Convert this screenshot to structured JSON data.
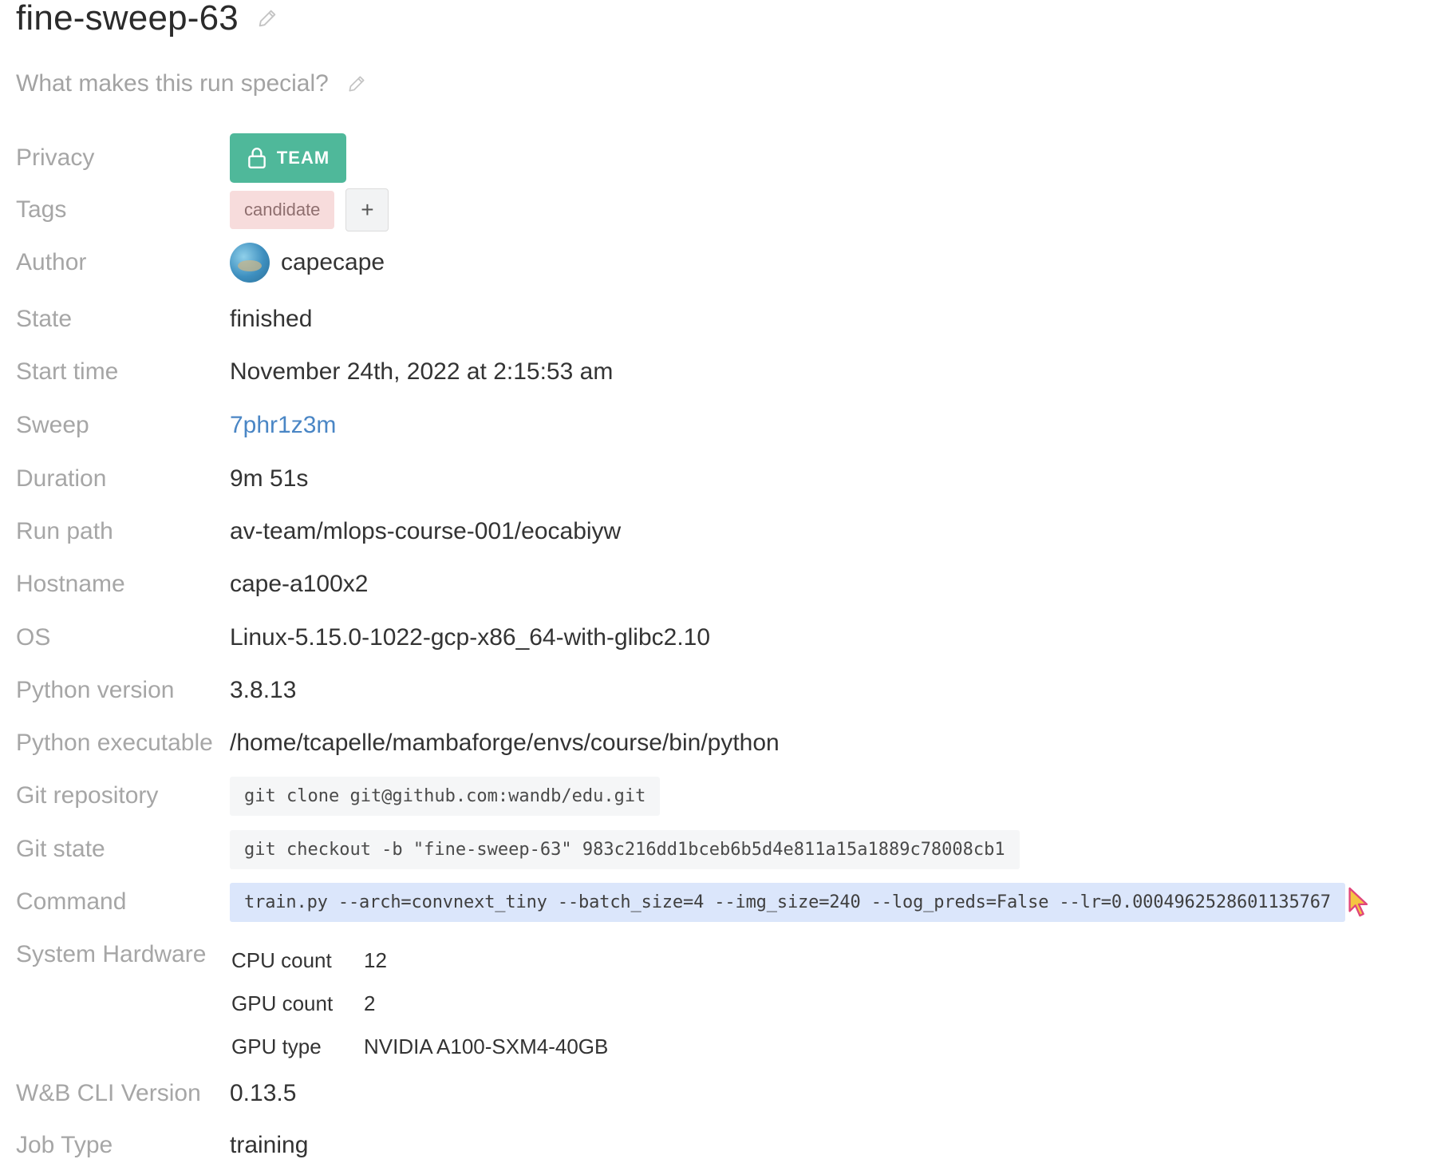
{
  "run": {
    "name": "fine-sweep-63",
    "description_placeholder": "What makes this run special?"
  },
  "privacy": {
    "label": "Privacy",
    "badge": "TEAM"
  },
  "tags": {
    "label": "Tags",
    "items": [
      "candidate"
    ],
    "add_button": "+"
  },
  "author": {
    "label": "Author",
    "name": "capecape"
  },
  "state": {
    "label": "State",
    "value": "finished"
  },
  "start_time": {
    "label": "Start time",
    "value": "November 24th, 2022 at 2:15:53 am"
  },
  "sweep": {
    "label": "Sweep",
    "value": "7phr1z3m"
  },
  "duration": {
    "label": "Duration",
    "value": "9m 51s"
  },
  "run_path": {
    "label": "Run path",
    "value": "av-team/mlops-course-001/eocabiyw"
  },
  "hostname": {
    "label": "Hostname",
    "value": "cape-a100x2"
  },
  "os": {
    "label": "OS",
    "value": "Linux-5.15.0-1022-gcp-x86_64-with-glibc2.10"
  },
  "python_version": {
    "label": "Python version",
    "value": "3.8.13"
  },
  "python_executable": {
    "label": "Python executable",
    "value": "/home/tcapelle/mambaforge/envs/course/bin/python"
  },
  "git_repository": {
    "label": "Git repository",
    "value": "git clone git@github.com:wandb/edu.git"
  },
  "git_state": {
    "label": "Git state",
    "value": "git checkout -b \"fine-sweep-63\" 983c216dd1bceb6b5d4e811a15a1889c78008cb1"
  },
  "command": {
    "label": "Command",
    "value": "train.py --arch=convnext_tiny --batch_size=4 --img_size=240 --log_preds=False --lr=0.0004962528601135767"
  },
  "system_hardware": {
    "label": "System Hardware",
    "rows": [
      {
        "key": "CPU count",
        "value": "12"
      },
      {
        "key": "GPU count",
        "value": "2"
      },
      {
        "key": "GPU type",
        "value": "NVIDIA A100-SXM4-40GB"
      }
    ]
  },
  "cli_version": {
    "label": "W&B CLI Version",
    "value": "0.13.5"
  },
  "job_type": {
    "label": "Job Type",
    "value": "training"
  },
  "colors": {
    "team_badge": "#4fb89a",
    "tag_bg": "#f7dcdc",
    "link": "#4a86c5",
    "selection": "#dbe6fb"
  },
  "icons": [
    "pencil-icon",
    "lock-icon",
    "plus-icon",
    "mouse-cursor-icon"
  ]
}
